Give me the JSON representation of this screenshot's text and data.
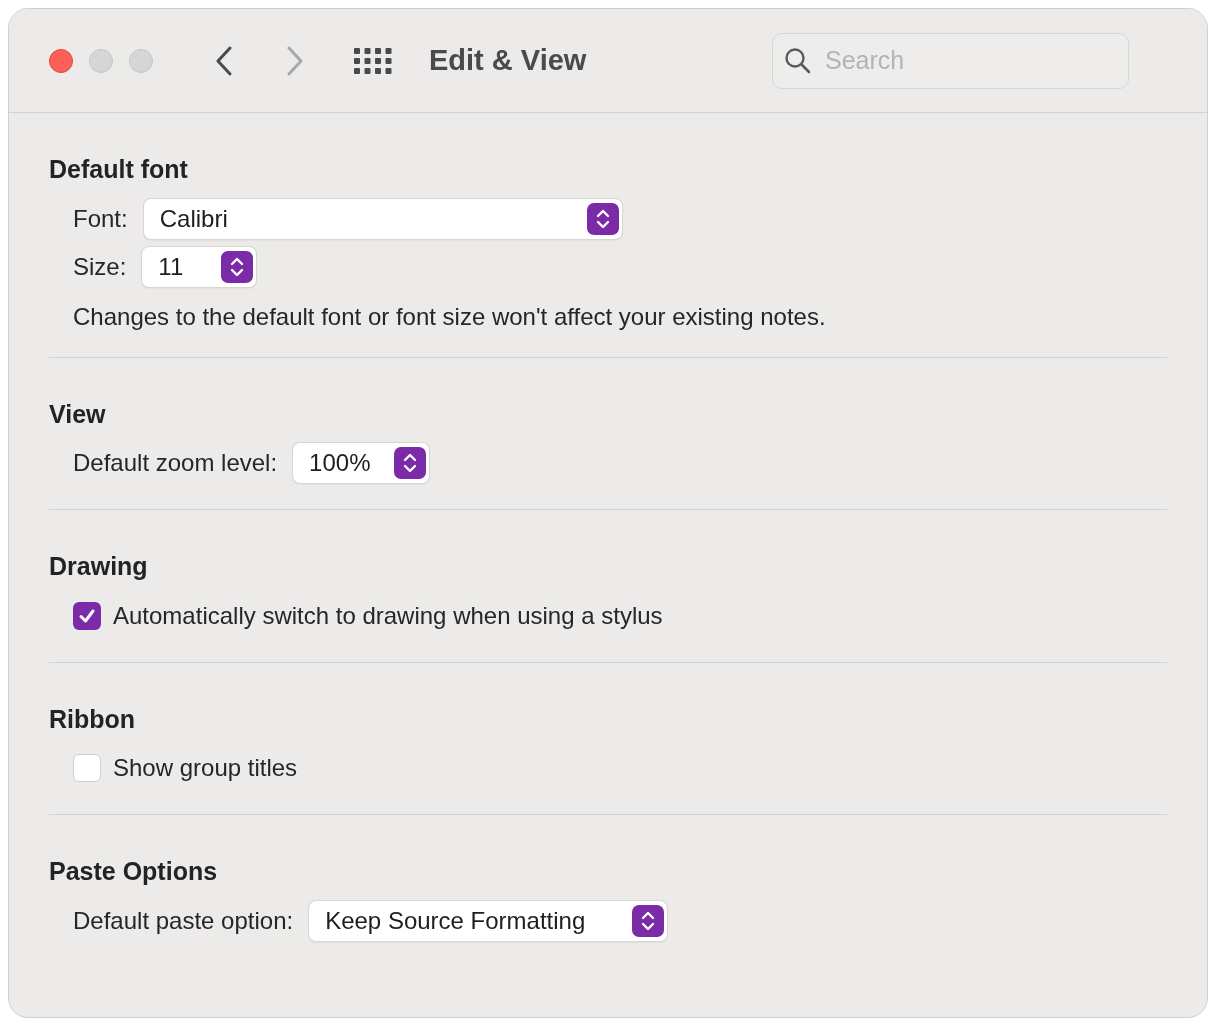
{
  "window": {
    "title": "Edit & View"
  },
  "nav": {
    "back_disabled": false,
    "forward_disabled": true
  },
  "search": {
    "placeholder": "Search"
  },
  "sections": [
    {
      "title": "Default font",
      "rows": [
        {
          "kind": "select",
          "label": "Font:",
          "value": "Calibri"
        },
        {
          "kind": "select",
          "label": "Size:",
          "value": "11"
        },
        {
          "kind": "note",
          "text": "Changes to the default font or font size won't affect your existing notes."
        }
      ]
    },
    {
      "title": "View",
      "rows": [
        {
          "kind": "select",
          "label": "Default zoom level:",
          "value": "100%"
        }
      ]
    },
    {
      "title": "Drawing",
      "rows": [
        {
          "kind": "checkbox",
          "label": "Automatically switch to drawing when using a stylus",
          "checked": true
        }
      ]
    },
    {
      "title": "Ribbon",
      "rows": [
        {
          "kind": "checkbox",
          "label": "Show group titles",
          "checked": false
        }
      ]
    },
    {
      "title": "Paste Options",
      "rows": [
        {
          "kind": "select",
          "label": "Default paste option:",
          "value": "Keep Source Formatting"
        }
      ]
    }
  ]
}
